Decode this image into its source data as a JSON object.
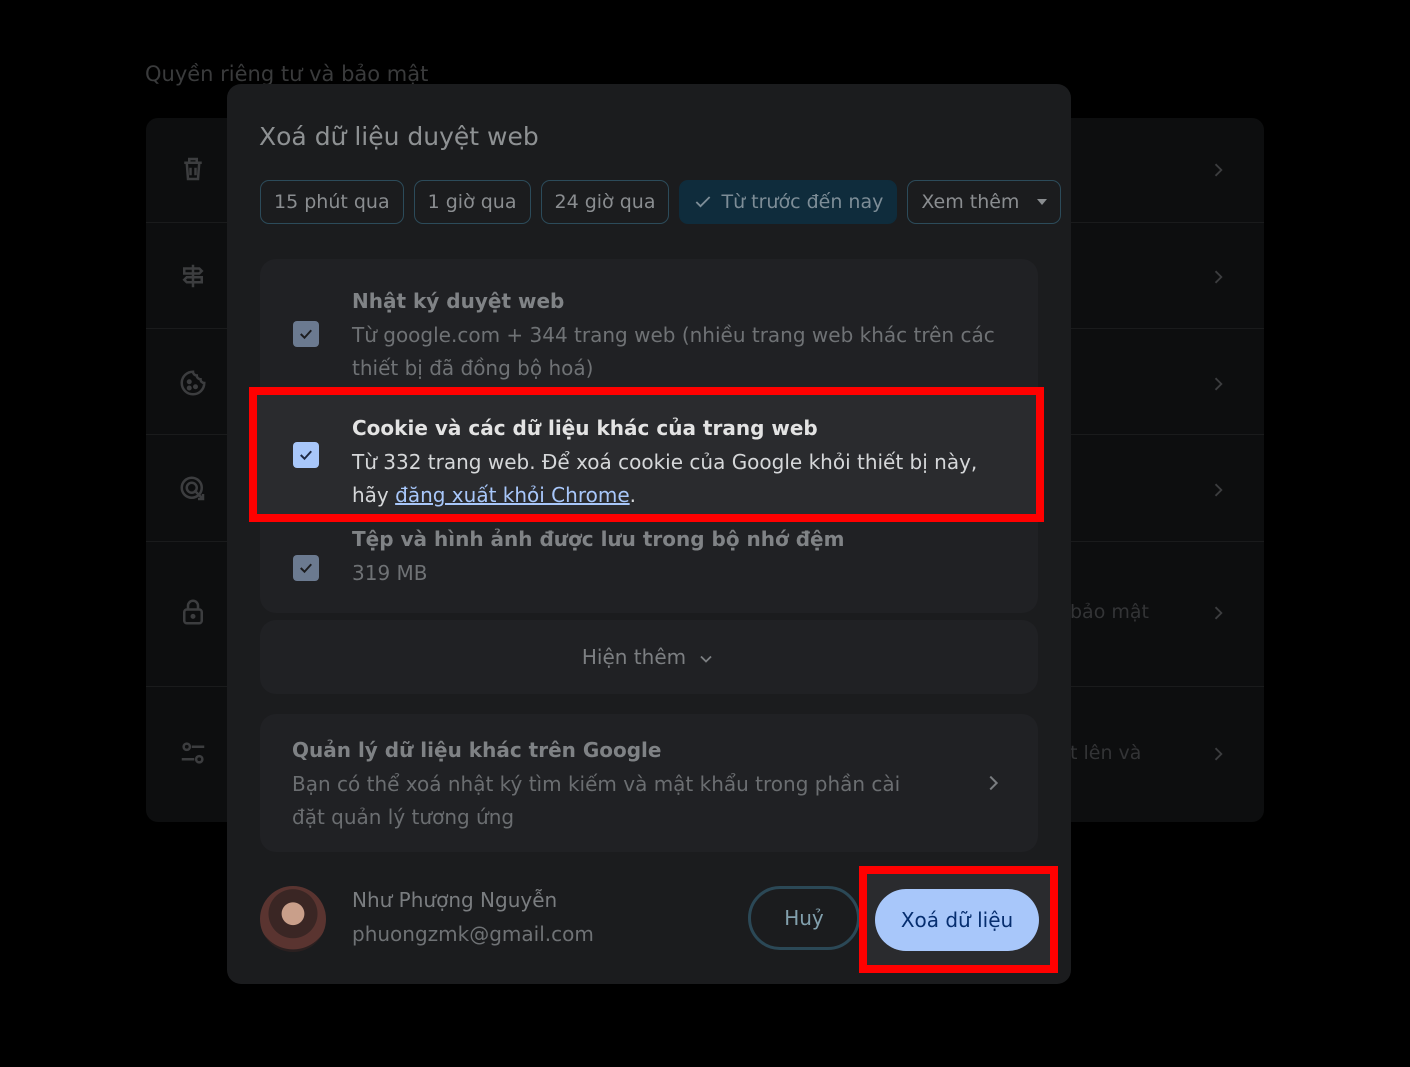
{
  "background": {
    "section_title": "Quyền riêng tư và bảo mật",
    "row_security_text": "bảo mật",
    "row_site_settings_text": "t lên và"
  },
  "dialog": {
    "title": "Xoá dữ liệu duyệt web",
    "time_ranges": [
      {
        "label": "15 phút qua"
      },
      {
        "label": "1 giờ qua"
      },
      {
        "label": "24 giờ qua"
      },
      {
        "label": "Từ trước đến nay"
      },
      {
        "label": "Xem thêm"
      }
    ],
    "items": [
      {
        "label": "Nhật ký duyệt web",
        "desc": "Từ google.com + 344 trang web (nhiều trang web khác trên các thiết bị đã đồng bộ hoá)"
      },
      {
        "label": "Cookie và các dữ liệu khác của trang web",
        "desc": "Từ 332 trang web. Để xoá cookie của Google khỏi thiết bị này, hãy ",
        "link": "đăng xuất khỏi Chrome",
        "desc_end": "."
      },
      {
        "label": "Tệp và hình ảnh được lưu trong bộ nhớ đệm",
        "desc": "319 MB"
      }
    ],
    "show_more": "Hiện thêm",
    "google_data": {
      "title": "Quản lý dữ liệu khác trên Google",
      "desc": "Bạn có thể xoá nhật ký tìm kiếm và mật khẩu trong phần cài đặt quản lý tương ứng"
    },
    "account": {
      "name": "Như Phượng Nguyễn",
      "email": "phuongzmk@gmail.com"
    },
    "cancel_label": "Huỷ",
    "delete_label": "Xoá dữ liệu"
  },
  "colors": {
    "accent": "#a8c7fa",
    "highlight": "#ff0000"
  }
}
